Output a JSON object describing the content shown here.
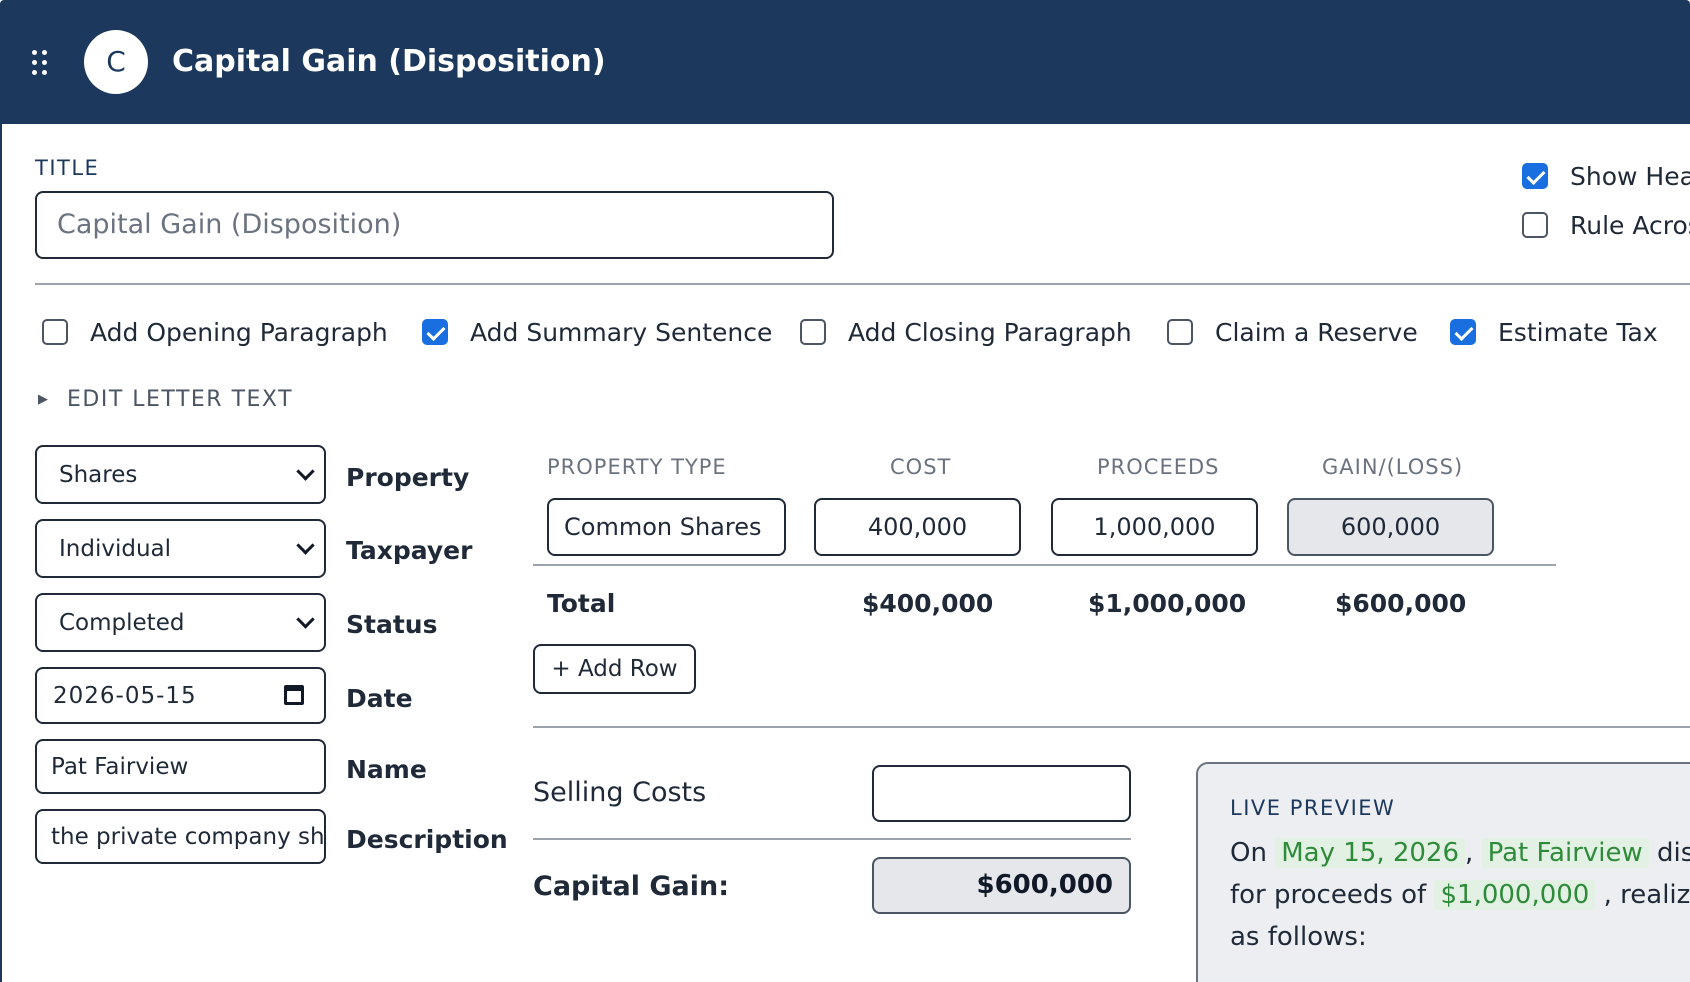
{
  "header": {
    "avatar_letter": "C",
    "title": "Capital Gain (Disposition)"
  },
  "title_section": {
    "label": "TITLE",
    "input_placeholder": "Capital Gain (Disposition)"
  },
  "side_options": [
    {
      "label": "Show Hea",
      "checked": true
    },
    {
      "label": "Rule Acros",
      "checked": false
    }
  ],
  "options": [
    {
      "label": "Add Opening Paragraph",
      "checked": false
    },
    {
      "label": "Add Summary Sentence",
      "checked": true
    },
    {
      "label": "Add Closing Paragraph",
      "checked": false
    },
    {
      "label": "Claim a Reserve",
      "checked": false
    },
    {
      "label": "Estimate Tax",
      "checked": true
    }
  ],
  "edit_letter_text": "EDIT LETTER TEXT",
  "fields": [
    {
      "kind": "select",
      "value": "Shares",
      "label": "Property"
    },
    {
      "kind": "select",
      "value": "Individual",
      "label": "Taxpayer"
    },
    {
      "kind": "select",
      "value": "Completed",
      "label": "Status"
    },
    {
      "kind": "date",
      "value": "2026-05-15",
      "label": "Date"
    },
    {
      "kind": "text",
      "value": "Pat Fairview",
      "label": "Name"
    },
    {
      "kind": "text",
      "value": "the private company sha",
      "label": "Description"
    }
  ],
  "table": {
    "headers": [
      "PROPERTY TYPE",
      "COST",
      "PROCEEDS",
      "GAIN/(LOSS)"
    ],
    "rows": [
      {
        "property_type": "Common Shares",
        "cost": "400,000",
        "proceeds": "1,000,000",
        "gain": "600,000"
      }
    ],
    "totals": {
      "label": "Total",
      "cost": "$400,000",
      "proceeds": "$1,000,000",
      "gain": "$600,000"
    },
    "add_row_label": "+ Add Row"
  },
  "selling_costs": {
    "label": "Selling Costs",
    "value": ""
  },
  "capital_gain": {
    "label": "Capital Gain:",
    "value": "$600,000"
  },
  "live_preview": {
    "label": "LIVE PREVIEW",
    "line1": {
      "prefix": "On",
      "date": "May 15, 2026",
      "sep": ",",
      "name": "Pat Fairview",
      "suffix": "dispo"
    },
    "line2": {
      "prefix": "for proceeds of",
      "amount": "$1,000,000",
      "suffix": ", realizing"
    },
    "line3": "as follows:"
  },
  "colors": {
    "header_bg": "#1c385d",
    "checkbox_checked": "#1a6fe0",
    "highlight_text": "#2e8b3a",
    "highlight_bg": "#e3f1e4"
  }
}
